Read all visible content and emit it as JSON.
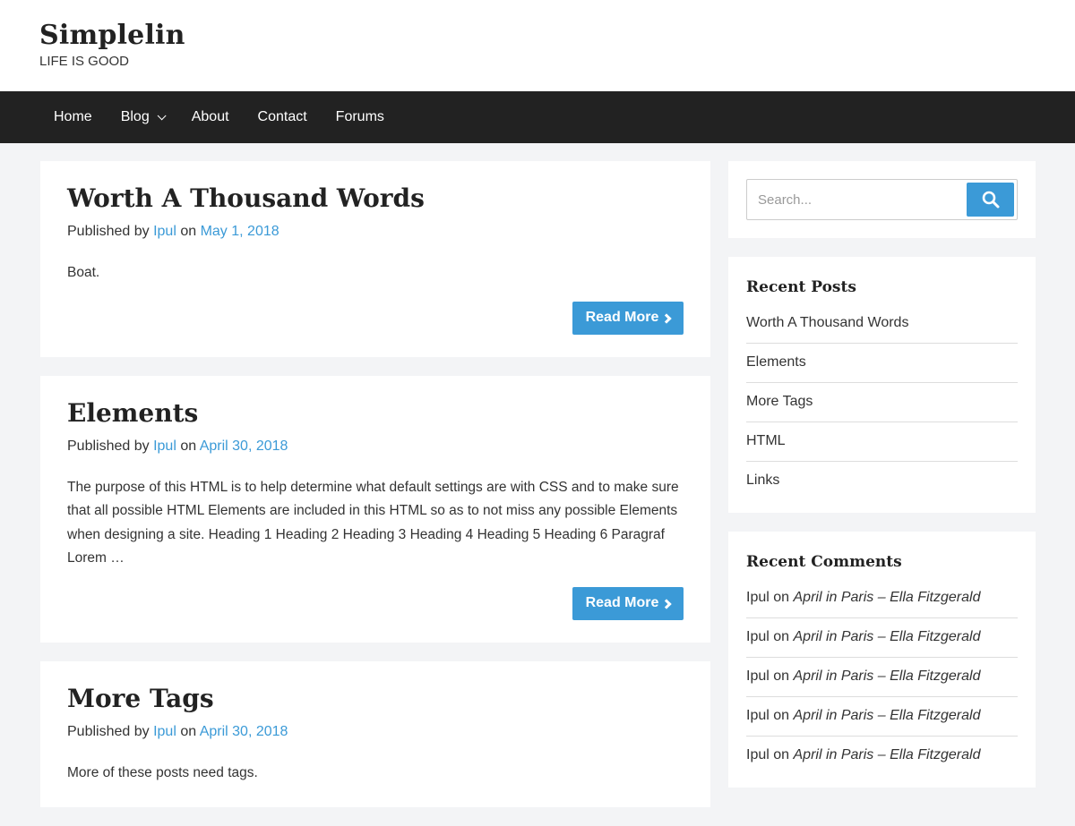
{
  "site": {
    "title": "Simplelin",
    "tagline": "LIFE IS GOOD"
  },
  "nav": {
    "items": [
      {
        "label": "Home"
      },
      {
        "label": "Blog"
      },
      {
        "label": "About"
      },
      {
        "label": "Contact"
      },
      {
        "label": "Forums"
      }
    ]
  },
  "posts": [
    {
      "title": "Worth A Thousand Words",
      "meta_prefix": "Published by",
      "author": "Ipul",
      "meta_on": "on",
      "date": "May 1, 2018",
      "excerpt": "Boat.",
      "read_more": "Read More"
    },
    {
      "title": "Elements",
      "meta_prefix": "Published by",
      "author": "Ipul",
      "meta_on": "on",
      "date": "April 30, 2018",
      "excerpt": "The purpose of this HTML is to help determine what default settings are with CSS and to make sure that all possible HTML Elements are included in this HTML so as to not miss any possible Elements when designing a site. Heading 1 Heading 2 Heading 3 Heading 4 Heading 5 Heading 6 Paragraf Lorem …",
      "read_more": "Read More"
    },
    {
      "title": "More Tags",
      "meta_prefix": "Published by",
      "author": "Ipul",
      "meta_on": "on",
      "date": "April 30, 2018",
      "excerpt": "More of these posts need tags."
    }
  ],
  "search": {
    "placeholder": "Search..."
  },
  "recent_posts": {
    "title": "Recent Posts",
    "items": [
      "Worth A Thousand Words",
      "Elements",
      "More Tags",
      "HTML",
      "Links"
    ]
  },
  "recent_comments": {
    "title": "Recent Comments",
    "items": [
      {
        "author": "Ipul",
        "on": "on",
        "post": "April in Paris – Ella Fitzgerald"
      },
      {
        "author": "Ipul",
        "on": "on",
        "post": "April in Paris – Ella Fitzgerald"
      },
      {
        "author": "Ipul",
        "on": "on",
        "post": "April in Paris – Ella Fitzgerald"
      },
      {
        "author": "Ipul",
        "on": "on",
        "post": "April in Paris – Ella Fitzgerald"
      },
      {
        "author": "Ipul",
        "on": "on",
        "post": "April in Paris – Ella Fitzgerald"
      }
    ]
  },
  "colors": {
    "accent": "#3b9ad7",
    "nav_bg": "#222222",
    "page_bg": "#f3f4f6"
  },
  "icons": {
    "search": "search-icon",
    "dropdown": "chevron-down-icon",
    "read_more": "chevron-right-icon"
  }
}
